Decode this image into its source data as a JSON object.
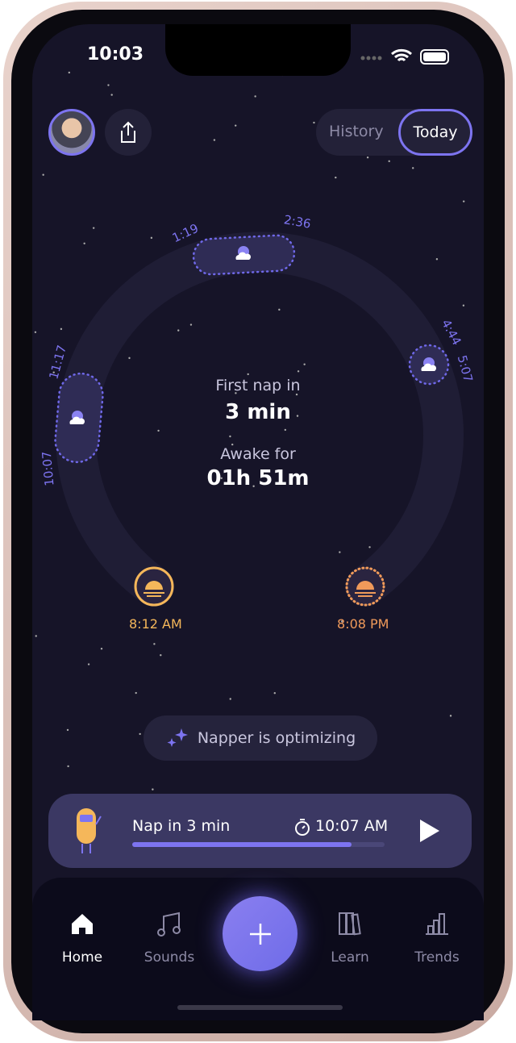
{
  "status": {
    "time": "10:03"
  },
  "header": {
    "segments": [
      {
        "label": "History",
        "active": false
      },
      {
        "label": "Today",
        "active": true
      }
    ]
  },
  "ring": {
    "naps": [
      {
        "start": "10:07",
        "end": "11:17"
      },
      {
        "start": "1:19",
        "end": "2:36"
      },
      {
        "start": "4:44",
        "end": "5:07"
      }
    ],
    "wake": {
      "time": "8:12 AM",
      "color": "#f5b75a"
    },
    "bedtime": {
      "time": "8:08 PM",
      "color": "#f09a5a"
    }
  },
  "summary": {
    "first_nap_label": "First nap in",
    "first_nap_value": "3 min",
    "awake_label": "Awake for",
    "awake_value": "01h 51m"
  },
  "optimizing": {
    "label": "Napper is optimizing"
  },
  "next_nap": {
    "label": "Nap in 3 min",
    "time": "10:07 AM",
    "progress": 0.87
  },
  "tabs": [
    {
      "label": "Home",
      "icon": "home-icon",
      "active": true
    },
    {
      "label": "Sounds",
      "icon": "music-note-icon"
    },
    {
      "label": "Learn",
      "icon": "books-icon"
    },
    {
      "label": "Trends",
      "icon": "bar-chart-icon"
    }
  ],
  "colors": {
    "accent": "#7d74f0",
    "background": "#161428"
  }
}
